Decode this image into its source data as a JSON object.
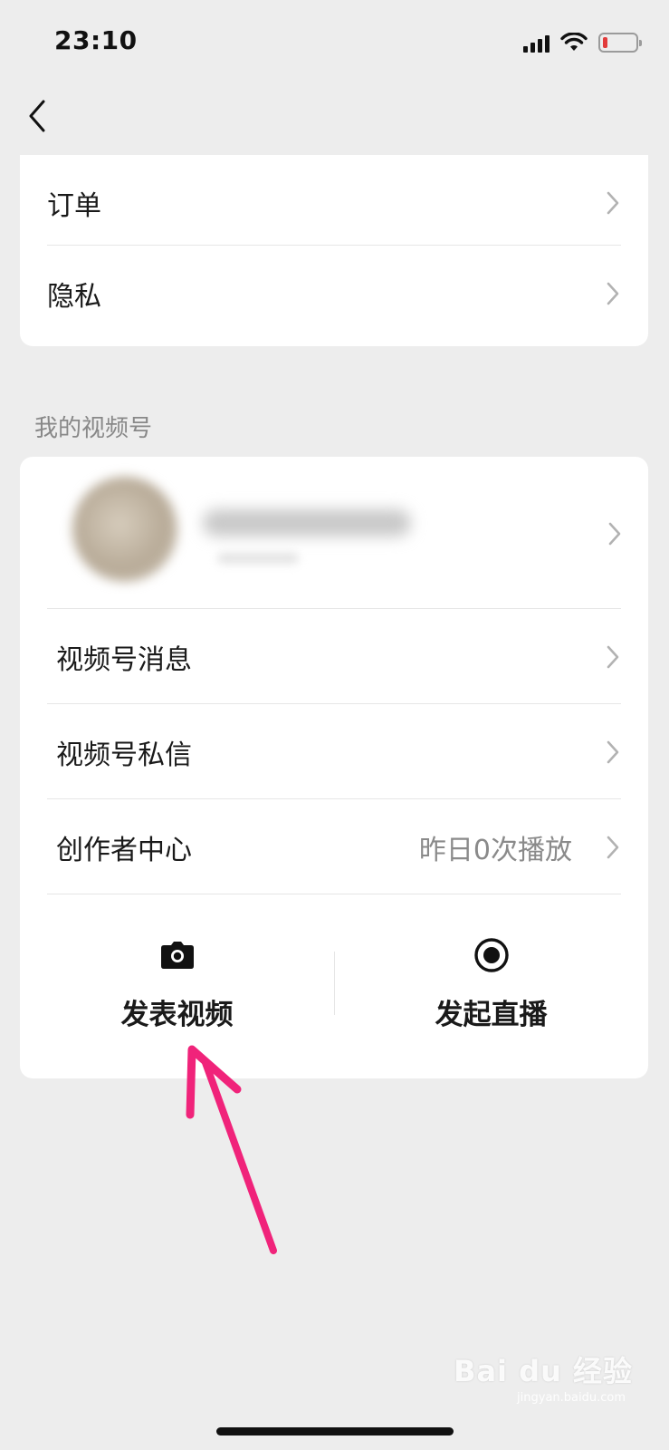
{
  "status_bar": {
    "time": "23:10",
    "battery_level": 0.15,
    "battery_color": "#e23b3b"
  },
  "nav": {
    "back_icon": "chevron-left-icon"
  },
  "menu_top": [
    {
      "label": "订单"
    },
    {
      "label": "隐私"
    }
  ],
  "section": {
    "title": "我的视频号"
  },
  "video_menu": [
    {
      "label": "视频号消息",
      "value": ""
    },
    {
      "label": "视频号私信",
      "value": ""
    },
    {
      "label": "创作者中心",
      "value": "昨日0次播放"
    }
  ],
  "actions": [
    {
      "label": "发表视频",
      "icon": "camera-icon"
    },
    {
      "label": "发起直播",
      "icon": "record-icon"
    }
  ],
  "annotation": {
    "color": "#f0237a",
    "icon": "arrow-up-icon"
  },
  "watermark": {
    "text": "Bai du 经验",
    "sub": "jingyan.baidu.com"
  }
}
